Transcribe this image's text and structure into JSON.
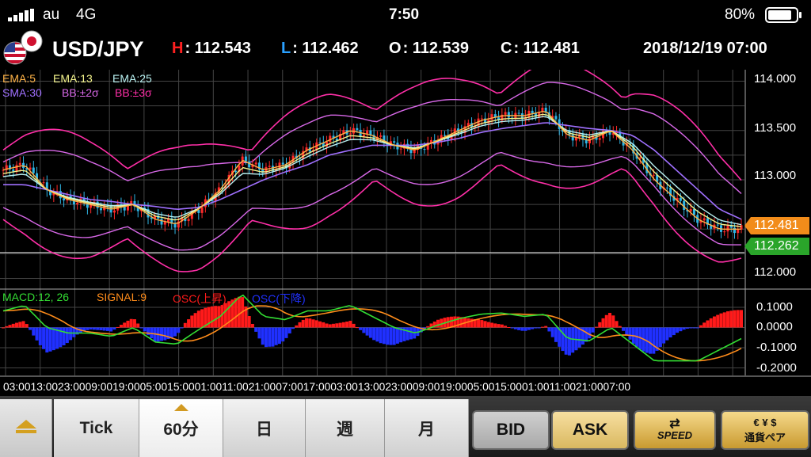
{
  "status": {
    "carrier": "au",
    "network": "4G",
    "time": "7:50",
    "battery": "80%"
  },
  "header": {
    "pair": "USD/JPY",
    "high_label": "H",
    "high_value": ": 112.543",
    "low_label": "L",
    "low_value": ": 112.462",
    "open_label": "O",
    "open_value": ": 112.539",
    "close_label": "C",
    "close_value": ": 112.481",
    "datetime": "2018/12/19 07:00"
  },
  "indicators": {
    "ema5": "EMA:5",
    "ema13": "EMA:13",
    "ema25": "EMA:25",
    "sma30": "SMA:30",
    "bb2": "BB:±2σ",
    "bb3": "BB:±3σ",
    "macd": "MACD:12, 26",
    "signal": "SIGNAL:9",
    "osc_up": "OSC(上昇)",
    "osc_down": "OSC(下降)"
  },
  "price_axis": {
    "ticks": [
      "114.000",
      "113.500",
      "113.000",
      "112.000"
    ],
    "current_price": "112.481",
    "line_price": "112.262"
  },
  "macd_axis": {
    "ticks": [
      "0.1000",
      "0.0000",
      "-0.1000",
      "-0.2000"
    ]
  },
  "time_axis": "03:0013:0023:0009:0019:0005:0015:0001:0011:0021:0007:0017:0003:0013:0023:0009:0019:0005:0015:0001:0011:0021:0007:00",
  "nav": {
    "tick": "Tick",
    "m60": "60分",
    "day": "日",
    "week": "週",
    "month": "月",
    "bid": "BID",
    "ask": "ASK",
    "speed": "SPEED",
    "pair_button": "通貨ペア"
  },
  "colors": {
    "up_candle": "#ff2a2a",
    "down_candle": "#2fb6e6",
    "ema5": "#ffb347",
    "ema13": "#f4f48c",
    "ema25": "#b8f0f0",
    "sma30": "#a070ff",
    "bb2": "#d868e8",
    "bb3": "#ff2fa8",
    "macd": "#33dd33",
    "signal": "#ff8c1a",
    "osc_up": "#ff1a1a",
    "osc_down": "#2030ff",
    "current_tag": "#f28c1a",
    "line_tag": "#2aa52a"
  },
  "chart_data": {
    "type": "line",
    "series": [
      {
        "name": "EMA:5",
        "values": [
          113.1,
          113.15,
          112.9,
          112.8,
          112.75,
          112.7,
          112.75,
          112.6,
          112.55,
          112.7,
          112.9,
          113.2,
          113.1,
          113.15,
          113.3,
          113.4,
          113.5,
          113.45,
          113.35,
          113.3,
          113.4,
          113.5,
          113.6,
          113.65,
          113.65,
          113.7,
          113.45,
          113.4,
          113.5,
          113.3,
          113.0,
          112.8,
          112.6,
          112.5,
          112.5
        ]
      },
      {
        "name": "SMA:30",
        "values": [
          112.95,
          112.95,
          112.9,
          112.85,
          112.8,
          112.78,
          112.75,
          112.73,
          112.7,
          112.72,
          112.8,
          112.9,
          113.0,
          113.08,
          113.15,
          113.25,
          113.3,
          113.35,
          113.35,
          113.35,
          113.38,
          113.42,
          113.48,
          113.52,
          113.55,
          113.58,
          113.55,
          113.52,
          113.5,
          113.45,
          113.3,
          113.1,
          112.9,
          112.7,
          112.6
        ]
      }
    ],
    "ylim": [
      111.9,
      114.1
    ],
    "current": 112.481,
    "hline": 112.262
  }
}
